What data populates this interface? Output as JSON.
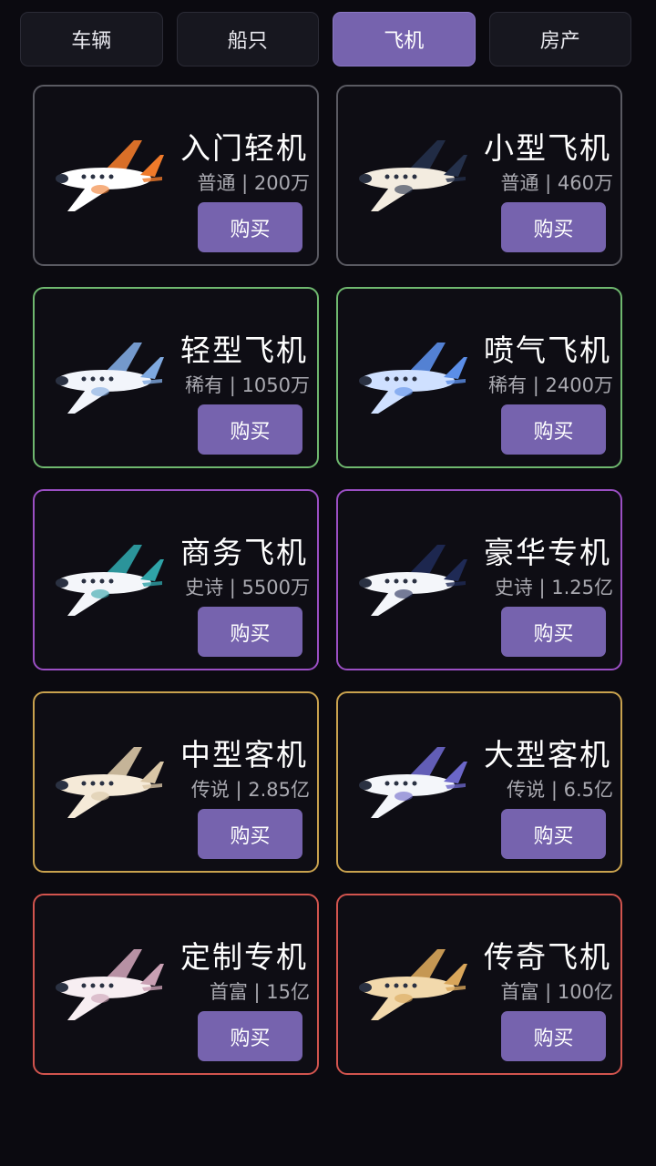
{
  "tabs": [
    {
      "label": "车辆"
    },
    {
      "label": "船只"
    },
    {
      "label": "飞机",
      "active": true
    },
    {
      "label": "房产"
    }
  ],
  "buy_label": "购买",
  "rarity_colors": {
    "普通": "#5a5a62",
    "稀有": "#6fb86f",
    "史诗": "#9b4fc4",
    "传说": "#c9a24e",
    "首富": "#d2544e"
  },
  "items": [
    {
      "name": "入门轻机",
      "rarity": "普通",
      "price": "200万",
      "meta": "普通 | 200万",
      "icon": "propeller-plane-orange-icon",
      "body": "#ffffff",
      "accent": "#f07a2a"
    },
    {
      "name": "小型飞机",
      "rarity": "普通",
      "price": "460万",
      "meta": "普通 | 460万",
      "icon": "small-jet-icon",
      "body": "#f3ece0",
      "accent": "#24304a"
    },
    {
      "name": "轻型飞机",
      "rarity": "稀有",
      "price": "1050万",
      "meta": "稀有 | 1050万",
      "icon": "twin-prop-plane-icon",
      "body": "#f2f5fb",
      "accent": "#7fa9e0"
    },
    {
      "name": "喷气飞机",
      "rarity": "稀有",
      "price": "2400万",
      "meta": "稀有 | 2400万",
      "icon": "jet-plane-blue-icon",
      "body": "#cfe0ff",
      "accent": "#5b8ee8"
    },
    {
      "name": "商务飞机",
      "rarity": "史诗",
      "price": "5500万",
      "meta": "史诗 | 5500万",
      "icon": "business-jet-icon",
      "body": "#f4f6fa",
      "accent": "#2fa3a8"
    },
    {
      "name": "豪华专机",
      "rarity": "史诗",
      "price": "1.25亿",
      "meta": "史诗 | 1.25亿",
      "icon": "luxury-jet-icon",
      "body": "#f4f6fa",
      "accent": "#1f2a55"
    },
    {
      "name": "中型客机",
      "rarity": "传说",
      "price": "2.85亿",
      "meta": "传说 | 2.85亿",
      "icon": "medium-airliner-icon",
      "body": "#f5ead8",
      "accent": "#d9c6a6"
    },
    {
      "name": "大型客机",
      "rarity": "传说",
      "price": "6.5亿",
      "meta": "传说 | 6.5亿",
      "icon": "large-airliner-icon",
      "body": "#f4f6fa",
      "accent": "#6b66c8"
    },
    {
      "name": "定制专机",
      "rarity": "首富",
      "price": "15亿",
      "meta": "首富 | 15亿",
      "icon": "custom-jet-pink-icon",
      "body": "#f7eef2",
      "accent": "#caa0b4"
    },
    {
      "name": "传奇飞机",
      "rarity": "首富",
      "price": "100亿",
      "meta": "首富 | 100亿",
      "icon": "golden-jet-icon",
      "body": "#f2d9ac",
      "accent": "#d9a65a"
    }
  ]
}
